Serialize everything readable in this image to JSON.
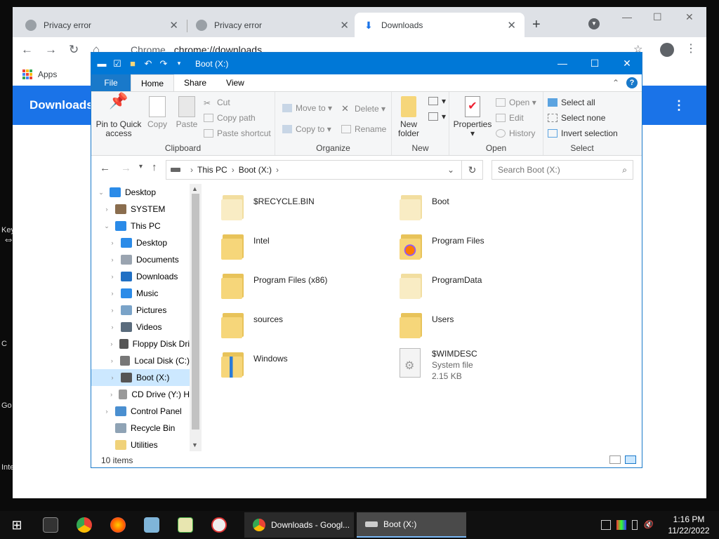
{
  "desktop": {
    "fragments": [
      "Key",
      "C",
      "Go",
      "Inte"
    ]
  },
  "chrome": {
    "tabs": [
      {
        "title": "Privacy error"
      },
      {
        "title": "Privacy error"
      },
      {
        "title": "Downloads"
      }
    ],
    "url_scheme": "Chrome",
    "url": "chrome://downloads",
    "bookmark_apps": "Apps",
    "page_title": "Downloads"
  },
  "explorer": {
    "title": "Boot (X:)",
    "ribbon_tabs": [
      "File",
      "Home",
      "Share",
      "View"
    ],
    "clipboard": {
      "group": "Clipboard",
      "pin_line1": "Pin to Quick",
      "pin_line2": "access",
      "copy": "Copy",
      "paste": "Paste",
      "cut": "Cut",
      "copy_path": "Copy path",
      "paste_shortcut": "Paste shortcut"
    },
    "organize": {
      "group": "Organize",
      "move_to": "Move to",
      "copy_to": "Copy to",
      "delete": "Delete",
      "rename": "Rename"
    },
    "new": {
      "group": "New",
      "line1": "New",
      "line2": "folder"
    },
    "open": {
      "group": "Open",
      "properties": "Properties",
      "open": "Open",
      "edit": "Edit",
      "history": "History"
    },
    "select": {
      "group": "Select",
      "select_all": "Select all",
      "select_none": "Select none",
      "invert": "Invert selection"
    },
    "breadcrumb": [
      "This PC",
      "Boot (X:)"
    ],
    "search_placeholder": "Search Boot (X:)",
    "nav": [
      {
        "label": "Desktop",
        "indent": 0,
        "arrow": "v",
        "color": "#2b8be8"
      },
      {
        "label": "SYSTEM",
        "indent": 1,
        "arrow": ">",
        "color": "#8a6d4e"
      },
      {
        "label": "This PC",
        "indent": 1,
        "arrow": "v",
        "color": "#2b8be8"
      },
      {
        "label": "Desktop",
        "indent": 2,
        "arrow": ">",
        "color": "#2b8be8"
      },
      {
        "label": "Documents",
        "indent": 2,
        "arrow": ">",
        "color": "#9aa4b0"
      },
      {
        "label": "Downloads",
        "indent": 2,
        "arrow": ">",
        "color": "#2170c4"
      },
      {
        "label": "Music",
        "indent": 2,
        "arrow": ">",
        "color": "#2b8be8"
      },
      {
        "label": "Pictures",
        "indent": 2,
        "arrow": ">",
        "color": "#7aa3c8"
      },
      {
        "label": "Videos",
        "indent": 2,
        "arrow": ">",
        "color": "#5a6b7c"
      },
      {
        "label": "Floppy Disk Dri",
        "indent": 2,
        "arrow": ">",
        "color": "#555555"
      },
      {
        "label": "Local Disk (C:)",
        "indent": 2,
        "arrow": ">",
        "color": "#777777"
      },
      {
        "label": "Boot (X:)",
        "indent": 2,
        "arrow": ">",
        "color": "#555555",
        "selected": true
      },
      {
        "label": "CD Drive (Y:) H",
        "indent": 2,
        "arrow": ">",
        "color": "#999999"
      },
      {
        "label": "Control Panel",
        "indent": 1,
        "arrow": ">",
        "color": "#4a8fd0"
      },
      {
        "label": "Recycle Bin",
        "indent": 1,
        "arrow": "",
        "color": "#8fa3b5"
      },
      {
        "label": "Utilities",
        "indent": 1,
        "arrow": "",
        "color": "#f0d27a"
      }
    ],
    "items": [
      {
        "name": "$RECYCLE.BIN",
        "kind": "folder-faded"
      },
      {
        "name": "Boot",
        "kind": "folder-faded"
      },
      {
        "name": "Intel",
        "kind": "folder"
      },
      {
        "name": "Program Files",
        "kind": "folder-firefox"
      },
      {
        "name": "Program Files (x86)",
        "kind": "folder"
      },
      {
        "name": "ProgramData",
        "kind": "folder-faded"
      },
      {
        "name": "sources",
        "kind": "folder"
      },
      {
        "name": "Users",
        "kind": "folder"
      },
      {
        "name": "Windows",
        "kind": "folder-win"
      },
      {
        "name": "$WIMDESC",
        "kind": "system",
        "type": "System file",
        "size": "2.15 KB"
      }
    ],
    "status": "10 items"
  },
  "taskbar": {
    "apps": [
      {
        "label": "Downloads - Googl...",
        "active": false
      },
      {
        "label": "Boot (X:)",
        "active": true
      }
    ],
    "time": "1:16 PM",
    "date": "11/22/2022"
  }
}
